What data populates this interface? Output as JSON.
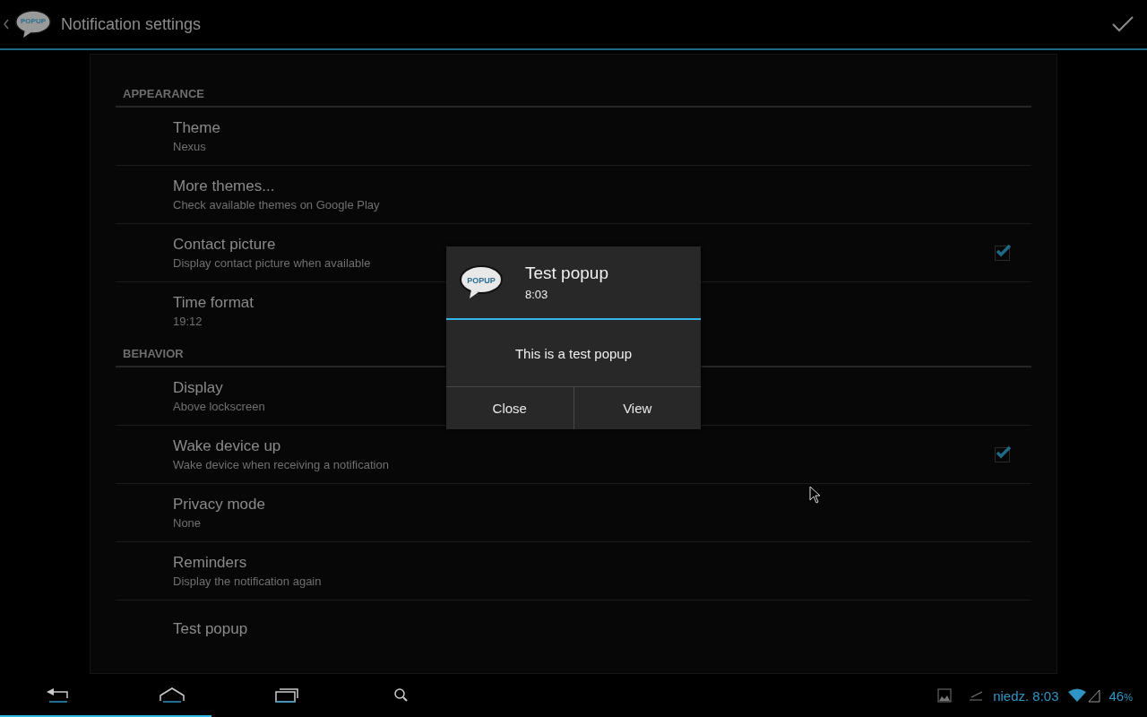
{
  "action_bar": {
    "title": "Notification settings",
    "logo_text": "POPUP"
  },
  "sections": [
    {
      "title": "APPEARANCE",
      "items": [
        {
          "kind": "plain",
          "title": "Theme",
          "summary": "Nexus"
        },
        {
          "kind": "plain",
          "title": "More themes...",
          "summary": "Check available themes on Google Play"
        },
        {
          "kind": "checkbox",
          "title": "Contact picture",
          "summary": "Display contact picture when available",
          "checked": true
        },
        {
          "kind": "plain",
          "title": "Time format",
          "summary": "19:12"
        }
      ]
    },
    {
      "title": "BEHAVIOR",
      "items": [
        {
          "kind": "plain",
          "title": "Display",
          "summary": "Above lockscreen"
        },
        {
          "kind": "checkbox",
          "title": "Wake device up",
          "summary": "Wake device when receiving a notification",
          "checked": true
        },
        {
          "kind": "plain",
          "title": "Privacy mode",
          "summary": "None"
        },
        {
          "kind": "plain",
          "title": "Reminders",
          "summary": "Display the notification again"
        },
        {
          "kind": "plain",
          "title": "Test popup"
        }
      ]
    }
  ],
  "dialog": {
    "logo_text": "POPUP",
    "title": "Test popup",
    "time": "8:03",
    "message": "This is a test popup",
    "buttons": [
      "Close",
      "View"
    ]
  },
  "status_bar": {
    "clock": "niedz. 8:03",
    "battery": "46",
    "battery_unit": "%"
  }
}
